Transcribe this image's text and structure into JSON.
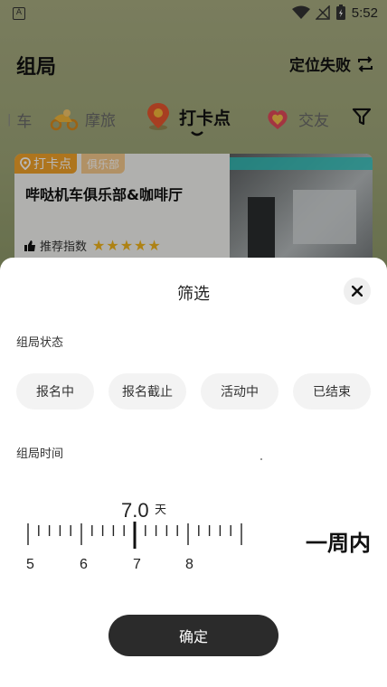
{
  "status": {
    "time": "5:52"
  },
  "header": {
    "title": "组局",
    "location_text": "定位失败"
  },
  "categories": [
    {
      "label": "车"
    },
    {
      "label": "摩旅"
    },
    {
      "label": "打卡点"
    },
    {
      "label": "交友"
    }
  ],
  "card": {
    "tag_primary": "打卡点",
    "tag_secondary": "俱乐部",
    "title": "哔哒机车俱乐部&咖啡厅",
    "recommend_label": "推荐指数",
    "stars": 5
  },
  "filter": {
    "title": "筛选",
    "status_label": "组局状态",
    "status_options": [
      "报名中",
      "报名截止",
      "活动中",
      "已结束"
    ],
    "time_label": "组局时间",
    "ruler_value": "7.0",
    "ruler_unit": "天",
    "ruler_ticks": [
      "5",
      "6",
      "7",
      "8"
    ],
    "range_text": "一周内",
    "confirm_label": "确定"
  },
  "colors": {
    "accent": "#f2a22a",
    "button": "#2b2b2b",
    "star": "#f1b51c"
  }
}
